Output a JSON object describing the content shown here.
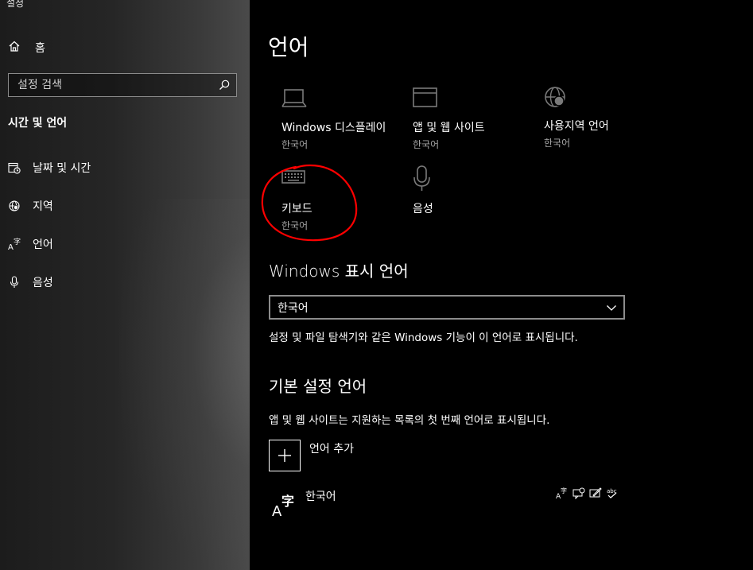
{
  "app": {
    "title": "설정"
  },
  "sidebar": {
    "home_label": "홈",
    "search_placeholder": "설정 검색",
    "section_title": "시간 및 언어",
    "items": [
      {
        "label": "날짜 및 시간",
        "icon": "calendar-clock-icon"
      },
      {
        "label": "지역",
        "icon": "globe-icon"
      },
      {
        "label": "언어",
        "icon": "language-icon"
      },
      {
        "label": "음성",
        "icon": "microphone-icon"
      }
    ]
  },
  "main": {
    "title": "언어",
    "tiles": [
      {
        "name": "Windows 디스플레이",
        "sub": "한국어",
        "icon": "laptop-icon"
      },
      {
        "name": "앱 및 웹 사이트",
        "sub": "한국어",
        "icon": "window-icon"
      },
      {
        "name": "사용지역 언어",
        "sub": "한국어",
        "icon": "globe-icon"
      },
      {
        "name": "키보드",
        "sub": "한국어",
        "icon": "keyboard-icon"
      },
      {
        "name": "음성",
        "sub": "",
        "icon": "microphone-icon"
      }
    ],
    "display_language": {
      "heading": "Windows 표시 언어",
      "selected": "한국어",
      "description": "설정 및 파일 탐색기와 같은 Windows 기능이 이 언어로 표시됩니다."
    },
    "preferred_languages": {
      "heading": "기본 설정 언어",
      "description": "앱 및 웹 사이트는 지원하는 목록의 첫 번째 언어로 표시됩니다.",
      "add_label": "언어 추가",
      "languages": [
        {
          "name": "한국어",
          "features": [
            "display-language-icon",
            "speech-icon",
            "handwriting-icon",
            "spellcheck-icon"
          ]
        }
      ]
    }
  },
  "colors": {
    "annotation": "#ff0000",
    "sidebar_bg": "#262626",
    "main_bg": "#000000"
  }
}
